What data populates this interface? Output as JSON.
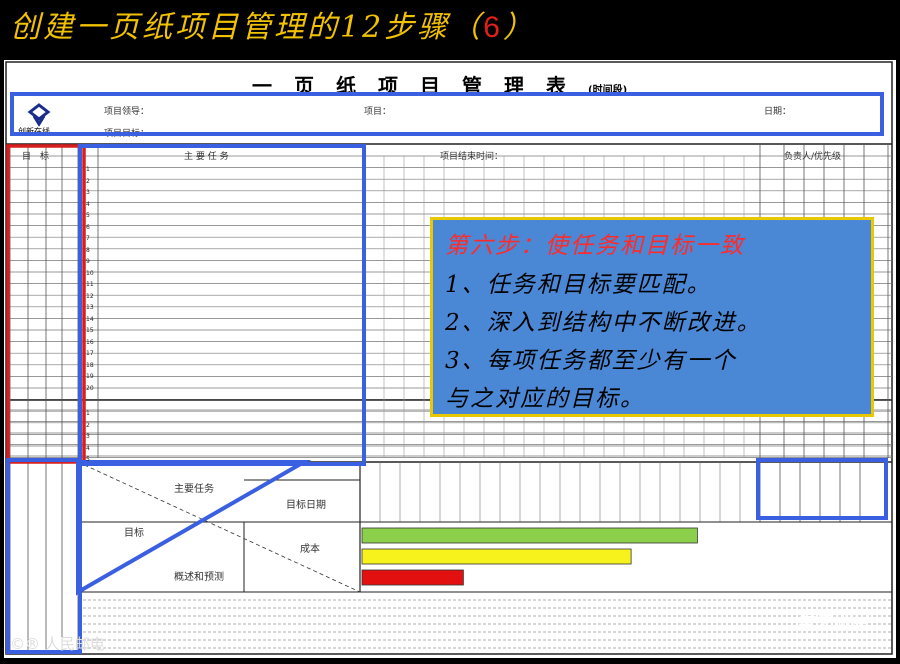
{
  "slide": {
    "title_prefix": "创建一页纸项目管理的12步骤（",
    "title_num": "6",
    "title_suffix": "）"
  },
  "sheet": {
    "title": "一页纸项目管理表",
    "title_sub": "(时间段)",
    "logo_text": "创新在线",
    "header": {
      "leader_label": "项目领导：",
      "project_label": "项目：",
      "date_label": "日期：",
      "goal_label": "项目目标："
    },
    "columns": {
      "goals": "目　标",
      "tasks": "主 要 任 务",
      "end_time": "项目结束时间：",
      "owner": "负责人/优先级"
    },
    "row_numbers": [
      "1",
      "2",
      "3",
      "4",
      "5",
      "6",
      "7",
      "8",
      "9",
      "10",
      "11",
      "12",
      "13",
      "14",
      "15",
      "16",
      "17",
      "18",
      "19",
      "20",
      "1",
      "2",
      "3",
      "4",
      "5"
    ],
    "bottom": {
      "main_tasks": "主要任务",
      "target_date": "目标日期",
      "goal": "目标",
      "cost": "成本",
      "summary": "概述和预测"
    },
    "bars": [
      {
        "value": 0.86,
        "color": "#8ccf4a"
      },
      {
        "value": 0.69,
        "color": "#f7f21c"
      },
      {
        "value": 0.26,
        "color": "#e31010"
      }
    ]
  },
  "callout": {
    "heading": "第六步：使任务和目标一致",
    "lines": [
      "1、任务和目标要匹配。",
      "2、深入到结构中不断改进。",
      "3、每项任务都至少有一个",
      "与之对应的目标。"
    ]
  },
  "watermarks": {
    "left": "©® 人民邮电",
    "right": "拿来即用"
  }
}
